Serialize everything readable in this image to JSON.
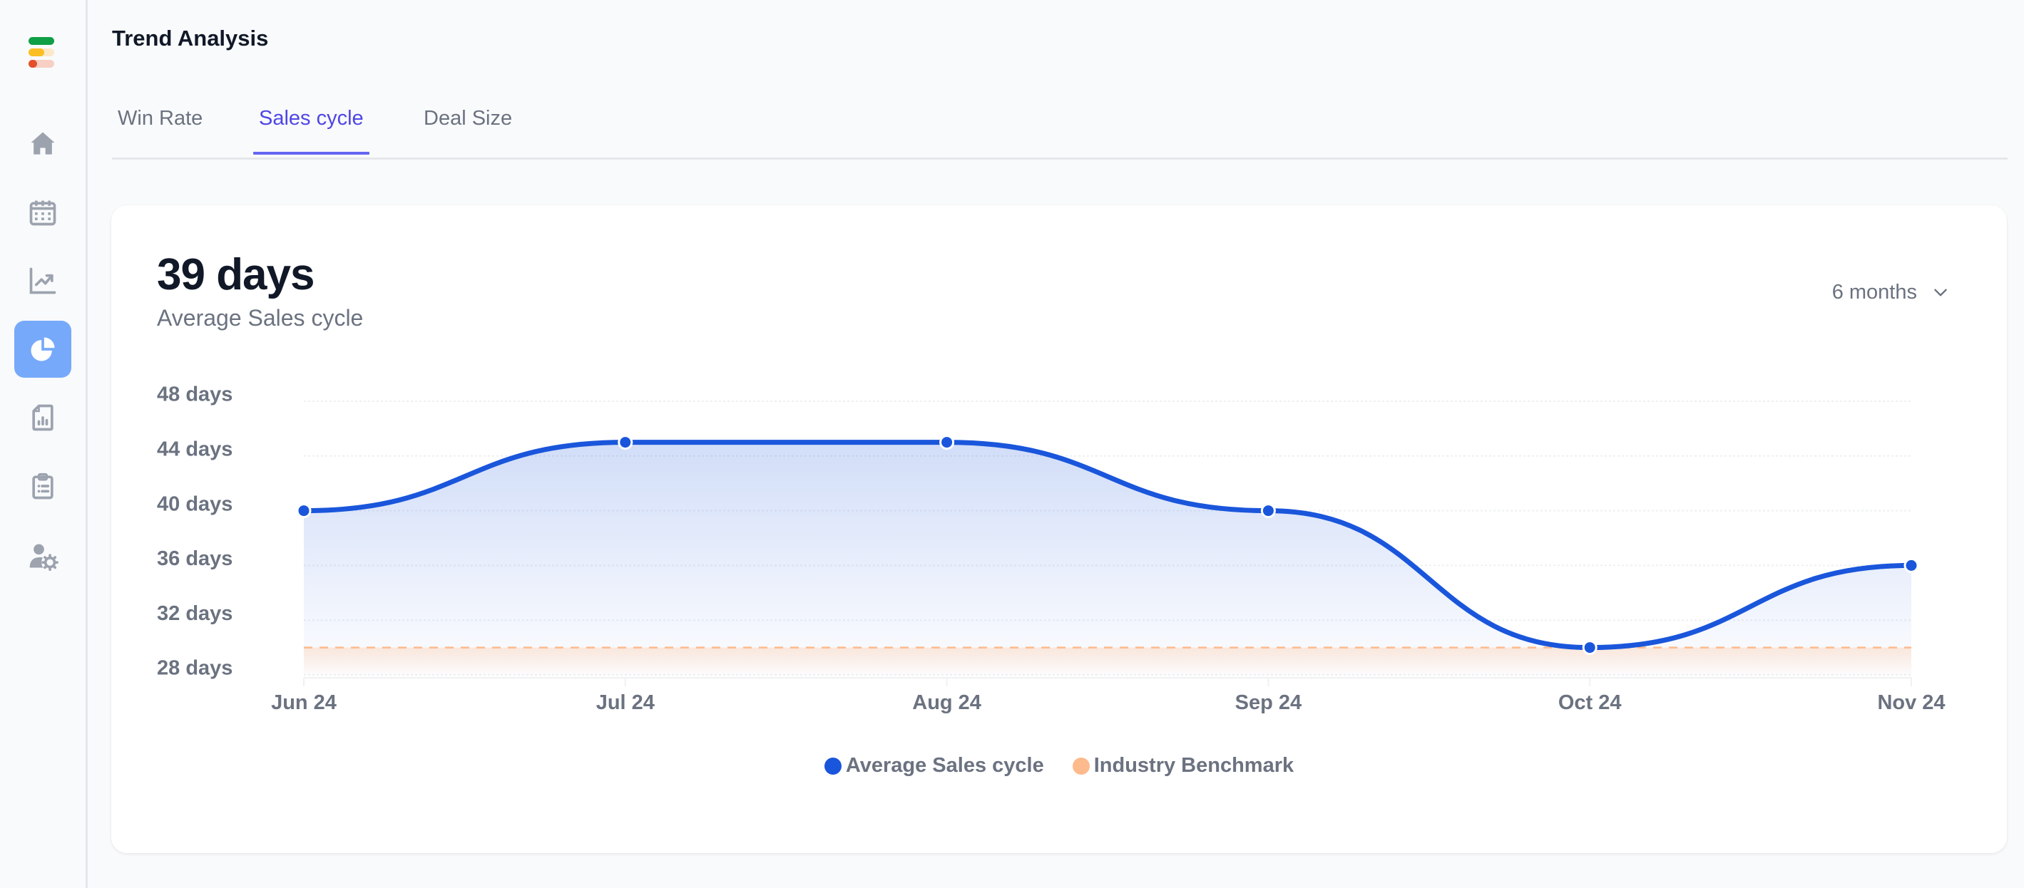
{
  "sidebar": {
    "items": [
      {
        "name": "home",
        "icon": "home-icon",
        "active": false
      },
      {
        "name": "calendar",
        "icon": "calendar-icon",
        "active": false
      },
      {
        "name": "trends",
        "icon": "trending-up-chart-icon",
        "active": false
      },
      {
        "name": "analytics",
        "icon": "pie-chart-icon",
        "active": true
      },
      {
        "name": "reports",
        "icon": "report-document-icon",
        "active": false
      },
      {
        "name": "tasks",
        "icon": "clipboard-list-icon",
        "active": false
      },
      {
        "name": "user-settings",
        "icon": "user-settings-icon",
        "active": false
      }
    ]
  },
  "header": {
    "title": "Trend Analysis"
  },
  "tabs": [
    {
      "label": "Win Rate",
      "active": false
    },
    {
      "label": "Sales cycle",
      "active": true
    },
    {
      "label": "Deal Size",
      "active": false
    }
  ],
  "card": {
    "metric_value": "39 days",
    "metric_label": "Average Sales cycle",
    "period_select": "6 months"
  },
  "colors": {
    "accent": "#4f46e5",
    "series_primary": "#1a56db",
    "series_benchmark": "#fdba8c",
    "active_nav": "#76a9fa"
  },
  "chart_data": {
    "type": "area",
    "categories": [
      "Jun 24",
      "Jul 24",
      "Aug 24",
      "Sep 24",
      "Oct 24",
      "Nov 24"
    ],
    "series": [
      {
        "name": "Average Sales cycle",
        "values": [
          40,
          45,
          45,
          40,
          30,
          36
        ],
        "color": "#1a56db"
      },
      {
        "name": "Industry Benchmark",
        "values": [
          30,
          30,
          30,
          30,
          30,
          30
        ],
        "color": "#fdba8c",
        "style": "dashed"
      }
    ],
    "yticks": [
      48,
      44,
      40,
      36,
      32,
      28
    ],
    "ytick_labels": [
      "48 days",
      "44 days",
      "40 days",
      "36 days",
      "32 days",
      "28 days"
    ],
    "ylim": [
      28,
      48
    ],
    "grid": true,
    "legend": [
      "Average Sales cycle",
      "Industry Benchmark"
    ],
    "legend_position": "bottom-center",
    "title": "",
    "xlabel": "",
    "ylabel": ""
  }
}
